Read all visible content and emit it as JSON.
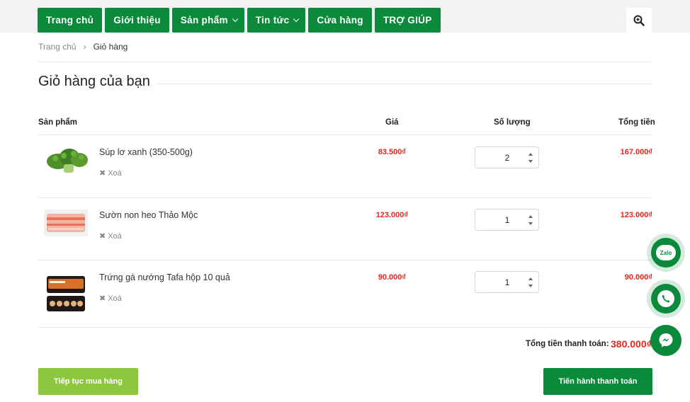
{
  "nav": {
    "items": [
      {
        "label": "Trang chủ"
      },
      {
        "label": "Giới thiệu"
      },
      {
        "label": "Sản phẩm"
      },
      {
        "label": "Tin tức"
      },
      {
        "label": "Cửa hàng"
      },
      {
        "label": "TRỢ GIÚP"
      }
    ]
  },
  "breadcrumb": {
    "home": "Trang chủ",
    "sep": "›",
    "current": "Giỏ hàng"
  },
  "page_title": "Giỏ hàng của bạn",
  "table": {
    "headers": {
      "product": "Sản phẩm",
      "price": "Giá",
      "qty": "Số lượng",
      "total": "Tổng tiền"
    },
    "rows": [
      {
        "name": "Súp lơ xanh (350-500g)",
        "delete": "Xoá",
        "price": "83.500₫",
        "qty": "2",
        "total": "167.000₫"
      },
      {
        "name": "Sườn non heo Thảo Mộc",
        "delete": "Xoá",
        "price": "123.000₫",
        "qty": "1",
        "total": "123.000₫"
      },
      {
        "name": "Trứng gà nướng Tafa hộp 10 quả",
        "delete": "Xoá",
        "price": "90.000₫",
        "qty": "1",
        "total": "90.000₫"
      }
    ]
  },
  "summary": {
    "label": "Tổng tiền thanh toán:",
    "value": "380.000₫"
  },
  "buttons": {
    "continue": "Tiếp tục mua hàng",
    "checkout": "Tiến hành thanh toán"
  },
  "floating": {
    "zalo": "Zalo"
  },
  "colors": {
    "brand_green": "#0b8a3c",
    "light_green": "#8dc63f",
    "price_red": "#e5261f",
    "messenger": "#0b8a3c"
  }
}
